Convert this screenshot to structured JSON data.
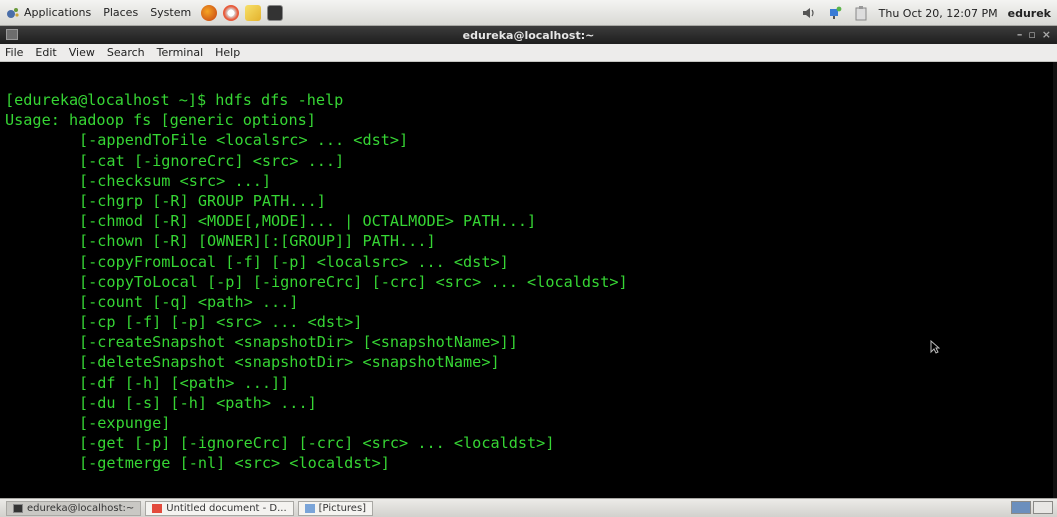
{
  "top_panel": {
    "menus": [
      "Applications",
      "Places",
      "System"
    ],
    "clock": "Thu Oct 20, 12:07 PM",
    "user": "edurek",
    "launcher_icons": [
      "firefox-icon",
      "help-icon",
      "notes-icon",
      "terminal-icon"
    ],
    "tray_icons": [
      "volume-icon",
      "network-icon",
      "clipboard-icon"
    ]
  },
  "window": {
    "title": "edureka@localhost:~",
    "menu": [
      "File",
      "Edit",
      "View",
      "Search",
      "Terminal",
      "Help"
    ]
  },
  "terminal": {
    "text_color": "#36d534",
    "background": "#000000",
    "lines": [
      "[edureka@localhost ~]$ hdfs dfs -help",
      "Usage: hadoop fs [generic options]",
      "[-appendToFile <localsrc> ... <dst>]",
      "[-cat [-ignoreCrc] <src> ...]",
      "[-checksum <src> ...]",
      "[-chgrp [-R] GROUP PATH...]",
      "[-chmod [-R] <MODE[,MODE]... | OCTALMODE> PATH...]",
      "[-chown [-R] [OWNER][:[GROUP]] PATH...]",
      "[-copyFromLocal [-f] [-p] <localsrc> ... <dst>]",
      "[-copyToLocal [-p] [-ignoreCrc] [-crc] <src> ... <localdst>]",
      "[-count [-q] <path> ...]",
      "[-cp [-f] [-p] <src> ... <dst>]",
      "[-createSnapshot <snapshotDir> [<snapshotName>]]",
      "[-deleteSnapshot <snapshotDir> <snapshotName>]",
      "[-df [-h] [<path> ...]]",
      "[-du [-s] [-h] <path> ...]",
      "[-expunge]",
      "[-get [-p] [-ignoreCrc] [-crc] <src> ... <localdst>]",
      "[-getmerge [-nl] <src> <localdst>]"
    ]
  },
  "taskbar": {
    "tasks": [
      {
        "label": "edureka@localhost:~",
        "icon": "terminal-icon",
        "active": true
      },
      {
        "label": "Untitled document - D...",
        "icon": "document-icon",
        "active": false
      },
      {
        "label": "[Pictures]",
        "icon": "folder-icon",
        "active": false
      }
    ]
  }
}
